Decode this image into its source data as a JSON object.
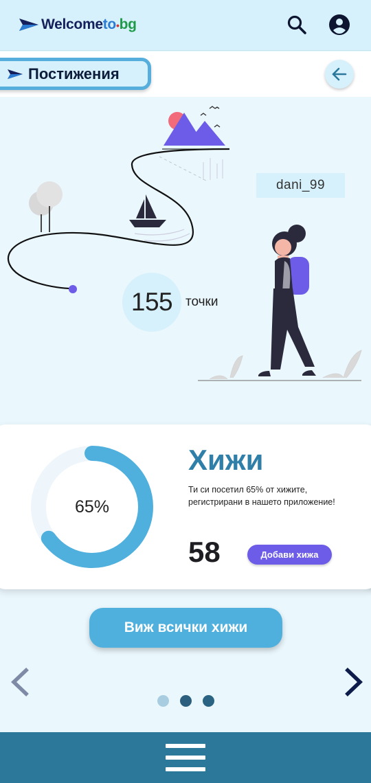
{
  "header": {
    "logo": {
      "part1": "Welcome",
      "part2": "to",
      "part3": "bg"
    },
    "search_icon": "search-icon",
    "profile_icon": "account-circle-icon"
  },
  "titlebar": {
    "title": "Постижения",
    "back_icon": "arrow-left-icon"
  },
  "profile": {
    "username": "dani_99",
    "points": "155",
    "points_label": "точки"
  },
  "card": {
    "progress": 0.65,
    "progress_label": "65%",
    "title": "Хижи",
    "description": "Ти си посетил 65% от хижите, регистрирани в нашето приложение!",
    "count": "58",
    "add_button": "Добави хижа"
  },
  "cta": {
    "label": "Виж всички хижи"
  },
  "carousel": {
    "prev_icon": "chevron-left-icon",
    "next_icon": "chevron-right-icon",
    "active_index": 1,
    "page_count": 3
  },
  "colors": {
    "accent": "#4fb0dd",
    "primary_dark": "#2b789b",
    "purple": "#6c5ce7",
    "title_blue": "#2f7fa8",
    "background": "#eaf7fd"
  }
}
